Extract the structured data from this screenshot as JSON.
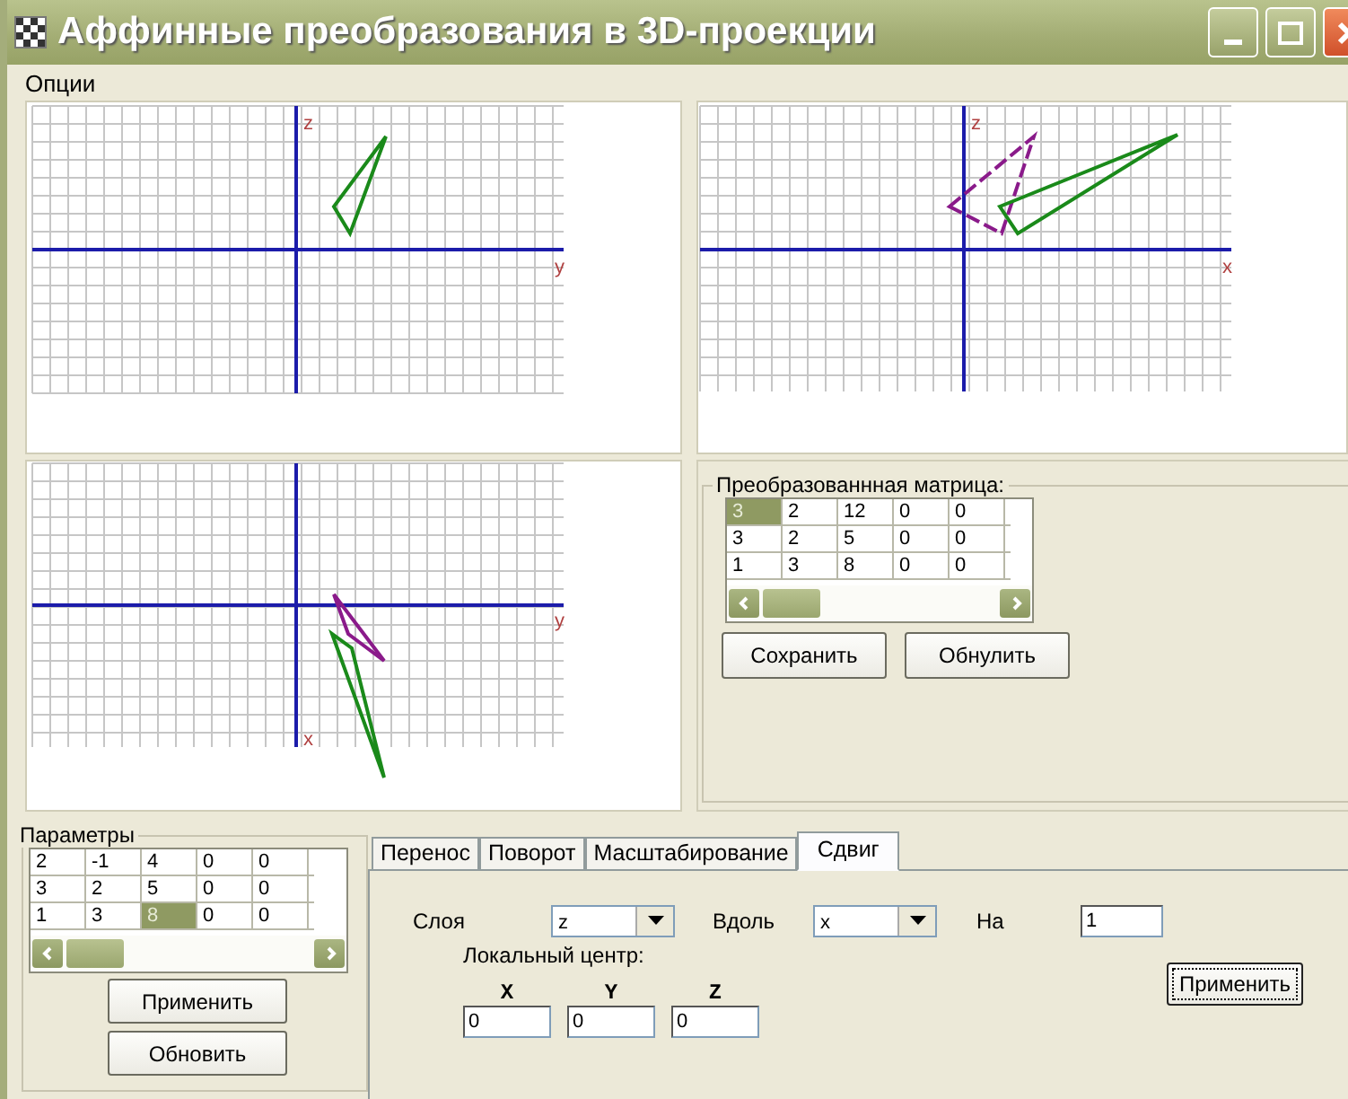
{
  "window": {
    "title": "Аффинные преобразования в 3D-проекции"
  },
  "menu": [
    {
      "label": "Опции"
    }
  ],
  "views": [
    {
      "vertical_label": "z",
      "horizontal_label": "y"
    },
    {
      "vertical_label": "z",
      "horizontal_label": "x"
    },
    {
      "vertical_label": "x",
      "horizontal_label": "y"
    }
  ],
  "matrix": {
    "title": "Преобразованнная матрица:",
    "rows": [
      {
        "cells": [
          {
            "text": "3",
            "selected": true
          },
          {
            "text": "2",
            "selected": false
          },
          {
            "text": "12",
            "selected": false
          },
          {
            "text": "0",
            "selected": false
          },
          {
            "text": "0",
            "selected": false
          }
        ]
      },
      {
        "cells": [
          {
            "text": "3",
            "selected": false
          },
          {
            "text": "2",
            "selected": false
          },
          {
            "text": "5",
            "selected": false
          },
          {
            "text": "0",
            "selected": false
          },
          {
            "text": "0",
            "selected": false
          }
        ]
      },
      {
        "cells": [
          {
            "text": "1",
            "selected": false
          },
          {
            "text": "3",
            "selected": false
          },
          {
            "text": "8",
            "selected": false
          },
          {
            "text": "0",
            "selected": false
          },
          {
            "text": "0",
            "selected": false
          }
        ]
      }
    ],
    "buttons": [
      "Сохранить",
      "Обнулить"
    ]
  },
  "params": {
    "title": "Параметры",
    "rows": [
      {
        "cells": [
          {
            "text": "2",
            "selected": false
          },
          {
            "text": "-1",
            "selected": false
          },
          {
            "text": "4",
            "selected": false
          },
          {
            "text": "0",
            "selected": false
          },
          {
            "text": "0",
            "selected": false
          }
        ]
      },
      {
        "cells": [
          {
            "text": "3",
            "selected": false
          },
          {
            "text": "2",
            "selected": false
          },
          {
            "text": "5",
            "selected": false
          },
          {
            "text": "0",
            "selected": false
          },
          {
            "text": "0",
            "selected": false
          }
        ]
      },
      {
        "cells": [
          {
            "text": "1",
            "selected": false
          },
          {
            "text": "3",
            "selected": false
          },
          {
            "text": "8",
            "selected": true
          },
          {
            "text": "0",
            "selected": false
          },
          {
            "text": "0",
            "selected": false
          }
        ]
      }
    ],
    "buttons": [
      "Применить",
      "Обновить"
    ]
  },
  "tabs": [
    {
      "label": "Перенос",
      "selected": false
    },
    {
      "label": "Поворот",
      "selected": false
    },
    {
      "label": "Масштабирование",
      "selected": false
    },
    {
      "label": "Сдвиг",
      "selected": true
    }
  ],
  "shear": {
    "plane_label": "Слоя",
    "plane_value": "z",
    "along_label": "Вдоль",
    "along_value": "x",
    "by_label": "На",
    "by_value": "1",
    "center_label": "Локальный центр:",
    "center": [
      {
        "axis": "X",
        "value": "0"
      },
      {
        "axis": "Y",
        "value": "0"
      },
      {
        "axis": "Z",
        "value": "0"
      }
    ],
    "apply_button": "Применить"
  }
}
